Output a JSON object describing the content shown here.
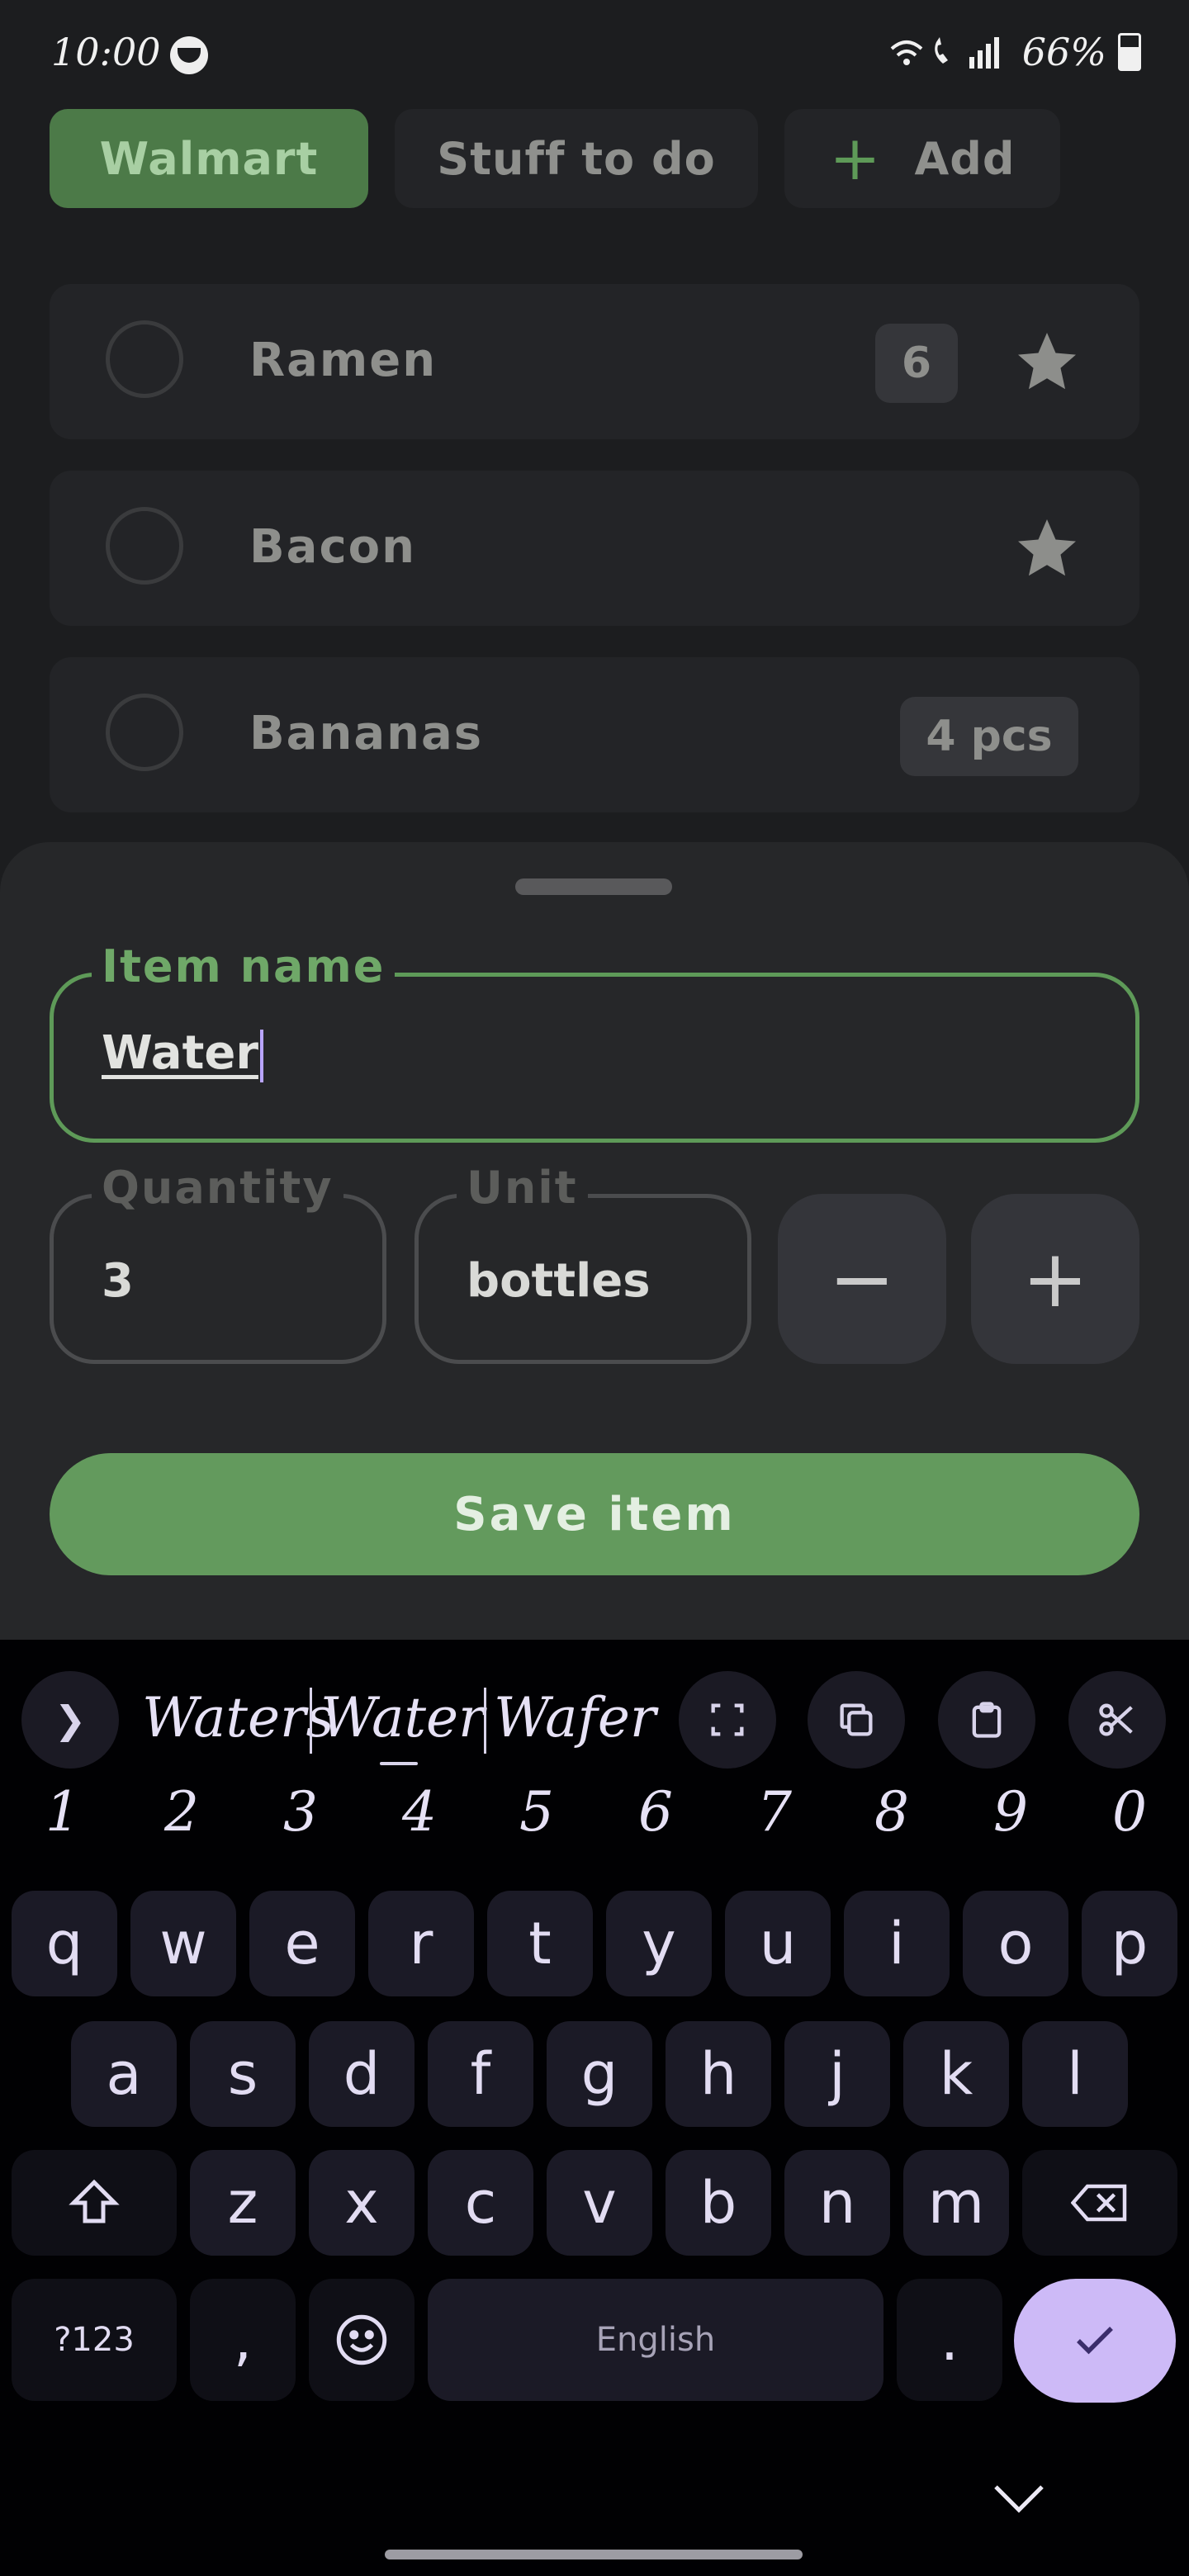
{
  "status": {
    "time": "10:00",
    "battery": "66%"
  },
  "tabs": [
    {
      "label": "Walmart",
      "active": true
    },
    {
      "label": "Stuff to do",
      "active": false
    },
    {
      "label": "Add",
      "icon": "plus-icon",
      "active": false
    }
  ],
  "items": [
    {
      "name": "Ramen",
      "badge": "6",
      "starred": true
    },
    {
      "name": "Bacon",
      "badge": "",
      "starred": true
    },
    {
      "name": "Bananas",
      "badge": "4 pcs",
      "starred": false
    }
  ],
  "sheet": {
    "item_name_label": "Item name",
    "item_name_value": "Water",
    "quantity_label": "Quantity",
    "quantity_value": "3",
    "unit_label": "Unit",
    "unit_value": "bottles",
    "decrement_label": "−",
    "increment_label": "+",
    "save_label": "Save item"
  },
  "keyboard": {
    "suggestions": [
      "Waters",
      "Water",
      "Wafer"
    ],
    "numbers": [
      "1",
      "2",
      "3",
      "4",
      "5",
      "6",
      "7",
      "8",
      "9",
      "0"
    ],
    "row1": [
      "q",
      "w",
      "e",
      "r",
      "t",
      "y",
      "u",
      "i",
      "o",
      "p"
    ],
    "row2": [
      "a",
      "s",
      "d",
      "f",
      "g",
      "h",
      "j",
      "k",
      "l"
    ],
    "row3": [
      "z",
      "x",
      "c",
      "v",
      "b",
      "n",
      "m"
    ],
    "symbols_label": "?123",
    "comma": ",",
    "space_label": "English",
    "period": "."
  },
  "colors": {
    "accent_green": "#639a5d",
    "keyboard_accent": "#cdbaf7"
  }
}
